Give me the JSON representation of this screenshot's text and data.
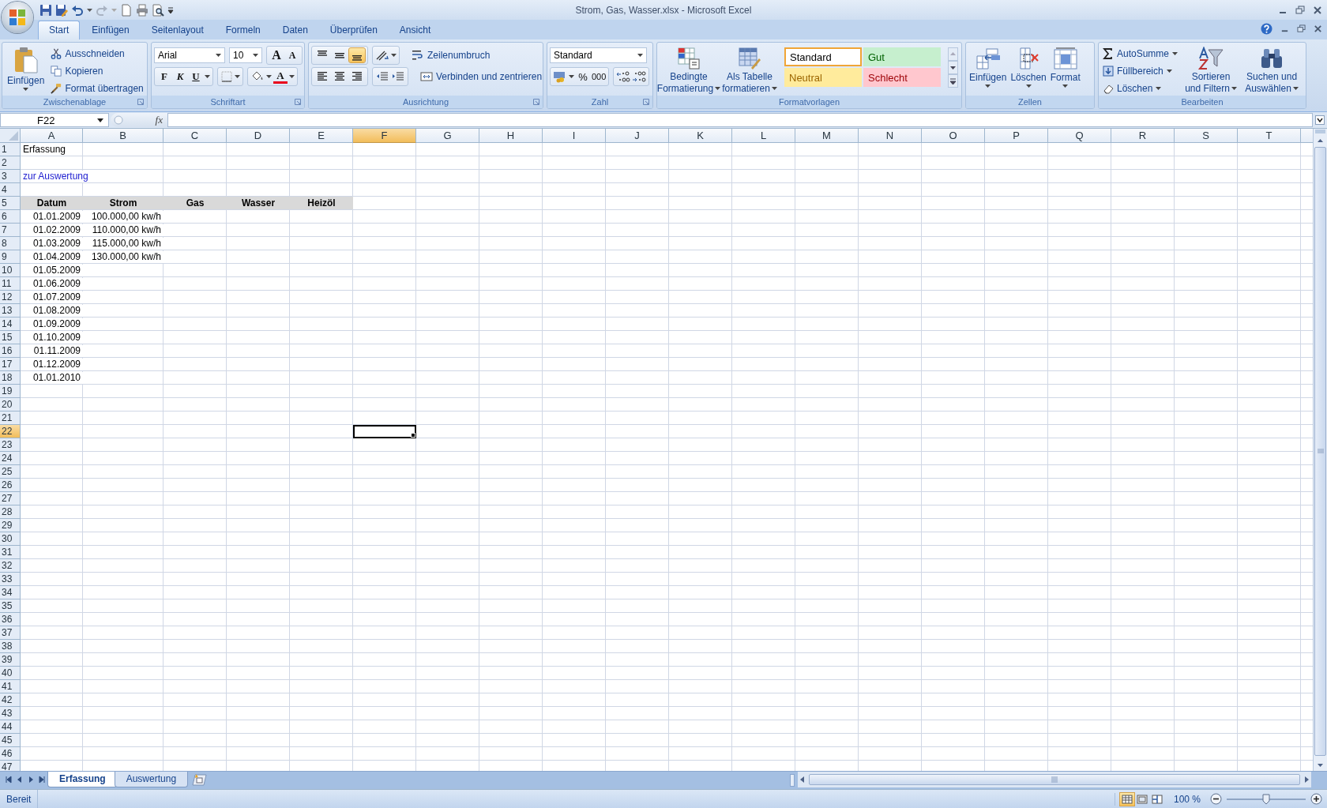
{
  "window": {
    "title": "Strom, Gas, Wasser.xlsx - Microsoft Excel"
  },
  "ribbon_tabs": [
    {
      "label": "Start",
      "selected": true
    },
    {
      "label": "Einfügen",
      "selected": false
    },
    {
      "label": "Seitenlayout",
      "selected": false
    },
    {
      "label": "Formeln",
      "selected": false
    },
    {
      "label": "Daten",
      "selected": false
    },
    {
      "label": "Überprüfen",
      "selected": false
    },
    {
      "label": "Ansicht",
      "selected": false
    }
  ],
  "ribbon": {
    "clipboard": {
      "name": "Zwischenablage",
      "paste": "Einfügen",
      "actions": [
        {
          "label": "Ausschneiden",
          "kind": "cut"
        },
        {
          "label": "Kopieren",
          "kind": "copy"
        },
        {
          "label": "Format übertragen",
          "kind": "painter"
        }
      ]
    },
    "font": {
      "name": "Schriftart",
      "family": "Arial",
      "size": "10",
      "grow": "A",
      "shrink": "A",
      "bold": "F",
      "italic": "K",
      "underline": "U",
      "text_color_button": "A"
    },
    "alignment": {
      "name": "Ausrichtung",
      "vertical": [
        {
          "kind": "top",
          "selected": false
        },
        {
          "kind": "middle",
          "selected": false
        },
        {
          "kind": "bottom",
          "selected": true
        }
      ],
      "horizontal": [
        {
          "kind": "left",
          "selected": false
        },
        {
          "kind": "center",
          "selected": false
        },
        {
          "kind": "right",
          "selected": false
        }
      ],
      "wrap": "Zeilenumbruch",
      "merge": "Verbinden und zentrieren"
    },
    "number": {
      "name": "Zahl",
      "format": "Standard",
      "percent": "%",
      "thousands": "000"
    },
    "styles": {
      "name": "Formatvorlagen",
      "conditional": [
        "Bedingte",
        "Formatierung"
      ],
      "as_table": [
        "Als Tabelle",
        "formatieren"
      ],
      "cell_styles": [
        {
          "label": "Standard",
          "kind": "normal",
          "selected": true
        },
        {
          "label": "Gut",
          "kind": "good",
          "selected": false
        },
        {
          "label": "Neutral",
          "kind": "neutral",
          "selected": false
        },
        {
          "label": "Schlecht",
          "kind": "bad",
          "selected": false
        }
      ]
    },
    "cells": {
      "name": "Zellen",
      "buttons": [
        {
          "label": "Einfügen",
          "kind": "insert"
        },
        {
          "label": "Löschen",
          "kind": "delete"
        },
        {
          "label": "Format",
          "kind": "format"
        }
      ]
    },
    "editing": {
      "name": "Bearbeiten",
      "actions": [
        {
          "label": "AutoSumme",
          "kind": "sum"
        },
        {
          "label": "Füllbereich",
          "kind": "fill"
        },
        {
          "label": "Löschen",
          "kind": "clear"
        }
      ],
      "big": [
        {
          "lines": [
            "Sortieren",
            "und Filtern"
          ],
          "kind": "sort"
        },
        {
          "lines": [
            "Suchen und",
            "Auswählen"
          ],
          "kind": "find"
        }
      ]
    }
  },
  "formula_bar": {
    "name_box": "F22",
    "fx": "fx"
  },
  "sheet": {
    "columns": [
      {
        "label": "A",
        "selected": false
      },
      {
        "label": "B",
        "selected": false
      },
      {
        "label": "C",
        "selected": false
      },
      {
        "label": "D",
        "selected": false
      },
      {
        "label": "E",
        "selected": false
      },
      {
        "label": "F",
        "selected": true
      },
      {
        "label": "G",
        "selected": false
      },
      {
        "label": "H",
        "selected": false
      },
      {
        "label": "I",
        "selected": false
      },
      {
        "label": "J",
        "selected": false
      },
      {
        "label": "K",
        "selected": false
      },
      {
        "label": "L",
        "selected": false
      },
      {
        "label": "M",
        "selected": false
      },
      {
        "label": "N",
        "selected": false
      },
      {
        "label": "O",
        "selected": false
      },
      {
        "label": "P",
        "selected": false
      },
      {
        "label": "Q",
        "selected": false
      },
      {
        "label": "R",
        "selected": false
      },
      {
        "label": "S",
        "selected": false
      },
      {
        "label": "T",
        "selected": false
      }
    ],
    "rows": [
      {
        "number": "1",
        "selected": false,
        "kind": "plain",
        "cells": [
          "Erfassung"
        ]
      },
      {
        "number": "2",
        "selected": false
      },
      {
        "number": "3",
        "selected": false,
        "kind": "link",
        "cells": [
          "zur Auswertung"
        ]
      },
      {
        "number": "4",
        "selected": false
      },
      {
        "number": "5",
        "selected": false,
        "kind": "header",
        "cells": [
          "Datum",
          "Strom",
          "Gas",
          "Wasser",
          "Heizöl"
        ]
      },
      {
        "number": "6",
        "selected": false,
        "kind": "date",
        "cells": [
          "01.01.2009",
          "100.000,00 kw/h"
        ]
      },
      {
        "number": "7",
        "selected": false,
        "kind": "date",
        "cells": [
          "01.02.2009",
          "110.000,00 kw/h"
        ]
      },
      {
        "number": "8",
        "selected": false,
        "kind": "date",
        "cells": [
          "01.03.2009",
          "115.000,00 kw/h"
        ]
      },
      {
        "number": "9",
        "selected": false,
        "kind": "date",
        "cells": [
          "01.04.2009",
          "130.000,00 kw/h"
        ]
      },
      {
        "number": "10",
        "selected": false,
        "kind": "date",
        "cells": [
          "01.05.2009"
        ]
      },
      {
        "number": "11",
        "selected": false,
        "kind": "date",
        "cells": [
          "01.06.2009"
        ]
      },
      {
        "number": "12",
        "selected": false,
        "kind": "date",
        "cells": [
          "01.07.2009"
        ]
      },
      {
        "number": "13",
        "selected": false,
        "kind": "date",
        "cells": [
          "01.08.2009"
        ]
      },
      {
        "number": "14",
        "selected": false,
        "kind": "date",
        "cells": [
          "01.09.2009"
        ]
      },
      {
        "number": "15",
        "selected": false,
        "kind": "date",
        "cells": [
          "01.10.2009"
        ]
      },
      {
        "number": "16",
        "selected": false,
        "kind": "date",
        "cells": [
          "01.11.2009"
        ]
      },
      {
        "number": "17",
        "selected": false,
        "kind": "date",
        "cells": [
          "01.12.2009"
        ]
      },
      {
        "number": "18",
        "selected": false,
        "kind": "date",
        "cells": [
          "01.01.2010"
        ]
      },
      {
        "number": "19",
        "selected": false
      },
      {
        "number": "20",
        "selected": false
      },
      {
        "number": "21",
        "selected": false
      },
      {
        "number": "22",
        "selected": true
      },
      {
        "number": "23",
        "selected": false
      },
      {
        "number": "24",
        "selected": false
      },
      {
        "number": "25",
        "selected": false
      },
      {
        "number": "26",
        "selected": false
      },
      {
        "number": "27",
        "selected": false
      },
      {
        "number": "28",
        "selected": false
      },
      {
        "number": "29",
        "selected": false
      },
      {
        "number": "30",
        "selected": false
      },
      {
        "number": "31",
        "selected": false
      },
      {
        "number": "32",
        "selected": false
      },
      {
        "number": "33",
        "selected": false
      },
      {
        "number": "34",
        "selected": false
      },
      {
        "number": "35",
        "selected": false
      },
      {
        "number": "36",
        "selected": false
      },
      {
        "number": "37",
        "selected": false
      },
      {
        "number": "38",
        "selected": false
      },
      {
        "number": "39",
        "selected": false
      },
      {
        "number": "40",
        "selected": false
      },
      {
        "number": "41",
        "selected": false
      },
      {
        "number": "42",
        "selected": false
      },
      {
        "number": "43",
        "selected": false
      },
      {
        "number": "44",
        "selected": false
      },
      {
        "number": "45",
        "selected": false
      },
      {
        "number": "46",
        "selected": false
      },
      {
        "number": "47",
        "selected": false
      }
    ]
  },
  "sheet_tabs": [
    {
      "label": "Erfassung",
      "selected": true
    },
    {
      "label": "Auswertung",
      "selected": false
    }
  ],
  "status_bar": {
    "text": "Bereit",
    "views": [
      {
        "kind": "normal",
        "selected": true
      },
      {
        "kind": "layout",
        "selected": false
      },
      {
        "kind": "pagebreak",
        "selected": false
      }
    ],
    "zoom": "100 %",
    "zoom_slider": {
      "level": 0.5
    }
  }
}
